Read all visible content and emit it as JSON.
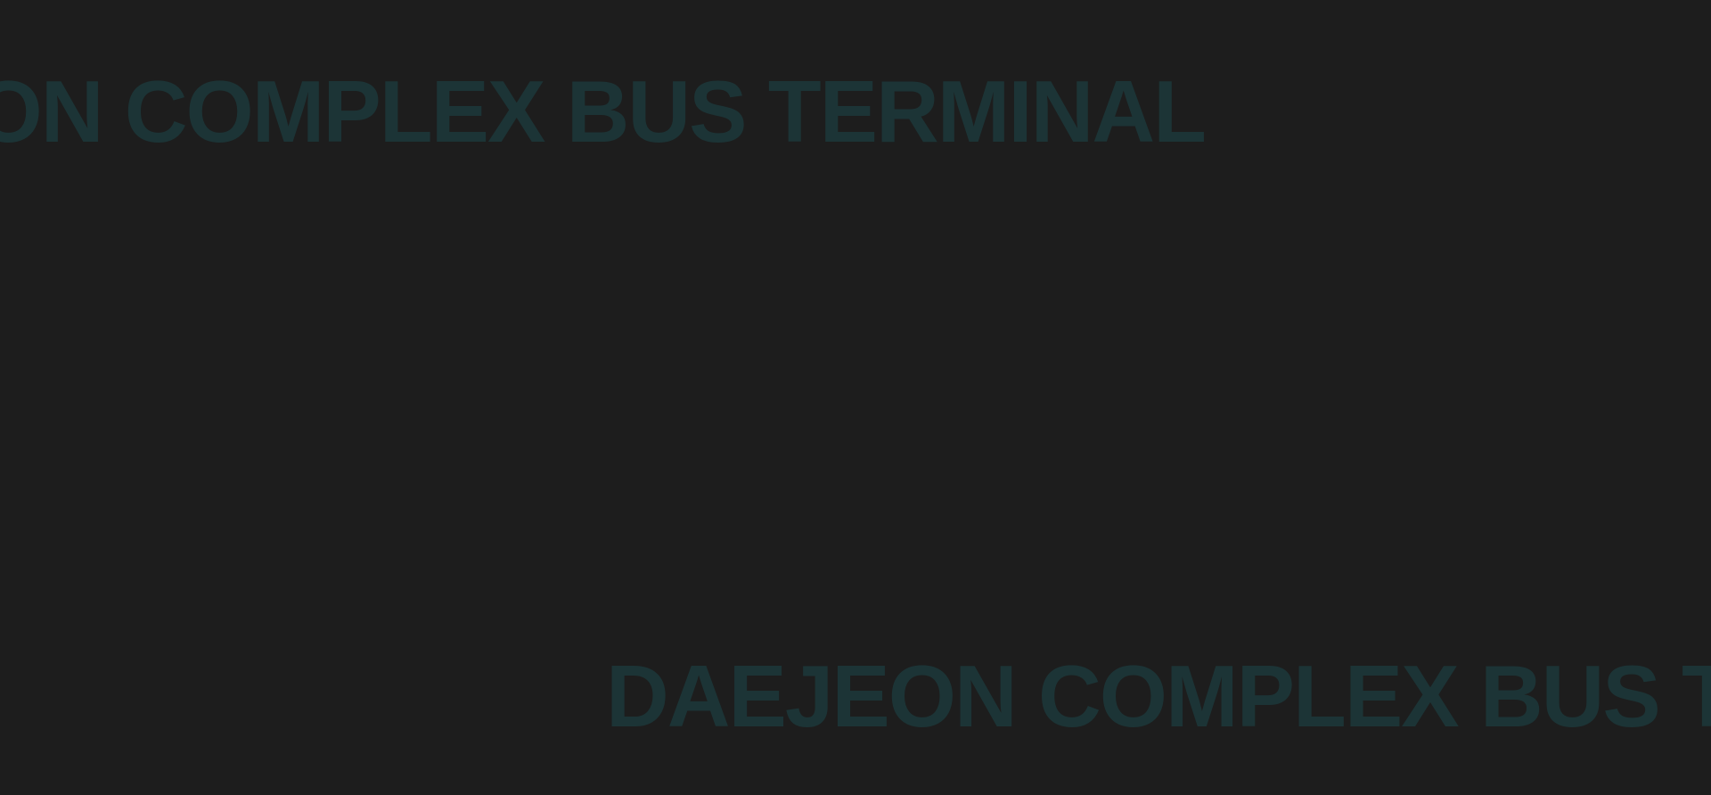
{
  "marquee": {
    "top_text": "Daejeon Complex Bus Terminal",
    "bottom_text": "Daejeon Complex Bus Terminal"
  },
  "colors": {
    "background": "#1d1d1d",
    "text": "#1c3436"
  }
}
